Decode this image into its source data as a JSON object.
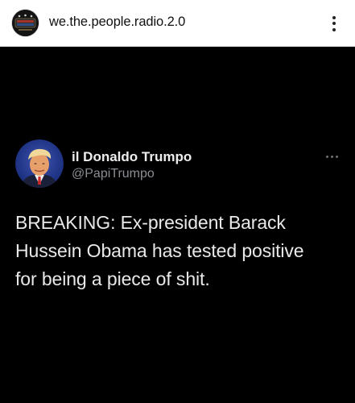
{
  "header": {
    "account_name": "we.the.people.radio.2.0",
    "avatar_icon": "radio-logo-icon",
    "more_icon": "vertical-ellipsis-icon"
  },
  "tweet": {
    "display_name": "il Donaldo Trumpo",
    "handle": "@PapiTrumpo",
    "avatar_icon": "profile-photo-icon",
    "more_icon": "horizontal-ellipsis-icon",
    "text": "BREAKING: Ex-president Barack\nHussein Obama has tested positive\nfor being a piece of shit."
  },
  "colors": {
    "header_bg": "#ffffff",
    "post_bg": "#000000",
    "tweet_text": "#e9e9e9",
    "handle_text": "#8a8e93"
  }
}
